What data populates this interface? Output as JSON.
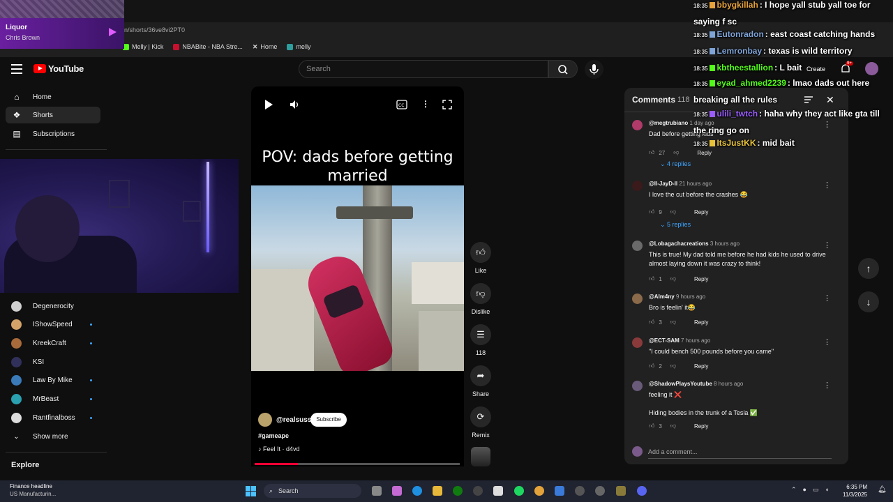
{
  "browser": {
    "address": "n/shorts/36ve8vi2PT0",
    "bookmarks": [
      {
        "label": "Melly | Kick",
        "color": "#53fc18"
      },
      {
        "label": "NBABite - NBA Stre...",
        "color": "#c8102e"
      },
      {
        "label": "Home",
        "color": "#ffffff"
      },
      {
        "label": "melly",
        "color": "#2f9e9e"
      }
    ]
  },
  "spotify": {
    "title": "Liquor",
    "artist": "Chris Brown"
  },
  "youtube": {
    "logo_text": "YouTube",
    "search_placeholder": "Search",
    "create_label": "Create",
    "notification_badge": "9+"
  },
  "sidebar": {
    "main": [
      {
        "label": "Home",
        "icon": "home-icon"
      },
      {
        "label": "Shorts",
        "icon": "shorts-icon"
      },
      {
        "label": "Subscriptions",
        "icon": "subscriptions-icon"
      }
    ],
    "subscriptions": [
      {
        "label": "Degenerocity",
        "color": "#cfcfcf",
        "dot": false
      },
      {
        "label": "IShowSpeed",
        "color": "#d4a36a",
        "dot": true
      },
      {
        "label": "KreekCraft",
        "color": "#a86a3a",
        "dot": true
      },
      {
        "label": "KSI",
        "color": "#30305a",
        "dot": false
      },
      {
        "label": "Law By Mike",
        "color": "#3a7ab8",
        "dot": true
      },
      {
        "label": "MrBeast",
        "color": "#2aa0b0",
        "dot": true
      },
      {
        "label": "Rantfinalboss",
        "color": "#dddddd",
        "dot": true
      }
    ],
    "show_more": "Show more",
    "explore": "Explore"
  },
  "short": {
    "caption_line1": "POV: dads before getting",
    "caption_line2": "married",
    "channel": "@realsuss",
    "subscribe_label": "Subscribe",
    "hashtag": "#gameape",
    "song": "Feel It · d4vd",
    "progress": 0.21,
    "actions": {
      "like": "Like",
      "dislike": "Dislike",
      "comments": "118",
      "share": "Share",
      "remix": "Remix"
    }
  },
  "comments": {
    "title": "Comments",
    "count": "118",
    "add_placeholder": "Add a comment...",
    "items": [
      {
        "author": "@megtrubiano",
        "time": "1 day ago",
        "text": "Dad before getting kids",
        "likes": "27",
        "avatar": "#b03a6a",
        "replies": "4 replies"
      },
      {
        "author": "@ll-JayD-ll",
        "time": "21 hours ago",
        "text": "I love the cut before the crashes 😂",
        "likes": "9",
        "avatar": "#3a1a1a",
        "replies": "5 replies"
      },
      {
        "author": "@Lobagachacreations",
        "time": "3 hours ago",
        "text": "This is true! My dad told me before he had kids he used to drive almost laying down it was crazy to think!",
        "likes": "1",
        "avatar": "#6a6a6a",
        "replies": ""
      },
      {
        "author": "@Alm4ny",
        "time": "9 hours ago",
        "text": "Bro is feelin' it😂",
        "likes": "3",
        "avatar": "#8a6a4a",
        "replies": ""
      },
      {
        "author": "@ECT-SAM",
        "time": "7 hours ago",
        "text": "\"I could bench 500 pounds before you came\"",
        "likes": "2",
        "avatar": "#8a3a3a",
        "replies": ""
      },
      {
        "author": "@ShadowPlaysYoutube",
        "time": "8 hours ago",
        "text": "feeling it ❌",
        "text2": "Hiding bodies in the trunk of a Tesla ✅",
        "likes": "3",
        "avatar": "#6a5a7a",
        "replies": ""
      }
    ]
  },
  "chat": [
    {
      "time": "18:35",
      "user": "bbygkillah",
      "color": "#e8a33a",
      "text": ": I hope yall stub yall toe for saying f sc"
    },
    {
      "time": "18:35",
      "user": "Eutonradon",
      "color": "#7fa4d8",
      "text": ": east coast catching hands"
    },
    {
      "time": "18:35",
      "user": "Lemronbay",
      "color": "#7fa4d8",
      "text": ": texas is wild territory"
    },
    {
      "time": "18:35",
      "user": "kbtheestallion",
      "color": "#53fc18",
      "text": ": L bait"
    },
    {
      "time": "18:35",
      "user": "eyad_ahmed2239",
      "color": "#53fc18",
      "text": ": lmao dads out here breaking all the rules"
    },
    {
      "time": "18:35",
      "user": "ulili_twtch",
      "color": "#9a5cff",
      "text": ": haha why they act like gta till the ring go on"
    },
    {
      "time": "18:35",
      "user": "ItsJustKK",
      "color": "#e8c33a",
      "text": ": mid bait"
    }
  ],
  "taskbar": {
    "news_title": "Finance headline",
    "news_sub": "US Manufacturin...",
    "search": "Search",
    "time": "6:35 PM",
    "date": "11/3/2025"
  }
}
